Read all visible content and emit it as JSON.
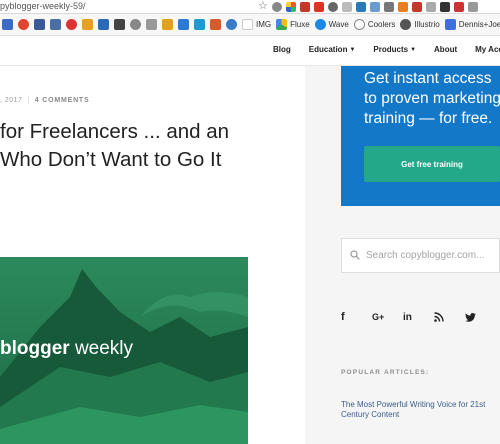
{
  "browser": {
    "url": "pyblogger-weekly-59/",
    "bookmarks": [
      "IMG",
      "Fluxe",
      "Wave",
      "Coolers",
      "Illustrio",
      "Dennis+Joel"
    ],
    "colors": {
      "toolbar": "#f7f7f7"
    }
  },
  "nav": {
    "items": [
      "Blog",
      "Education",
      "Products",
      "About",
      "My Acc"
    ]
  },
  "article": {
    "date": ", 2017",
    "comments": "4 COMMENTS",
    "headline_line1": "for Freelancers ... and an",
    "headline_line2": "Who Don’t Want to Go It",
    "hero_text_bold": "blogger",
    "hero_text_light": " weekly"
  },
  "sidebar": {
    "promo_text": "Get instant access to proven marketing training — for free.",
    "promo_button": "Get free training",
    "search_placeholder": "Search copyblogger.com...",
    "social": [
      "f",
      "G+",
      "in",
      "rss-icon",
      "twitter-icon"
    ],
    "popular_heading": "POPULAR ARTICLES:",
    "popular_link": "The Most Powerful Writing Voice for 21st Century Content",
    "colors": {
      "promo": "#1478c8",
      "button": "#23a889",
      "link": "#3a5f8a"
    }
  }
}
